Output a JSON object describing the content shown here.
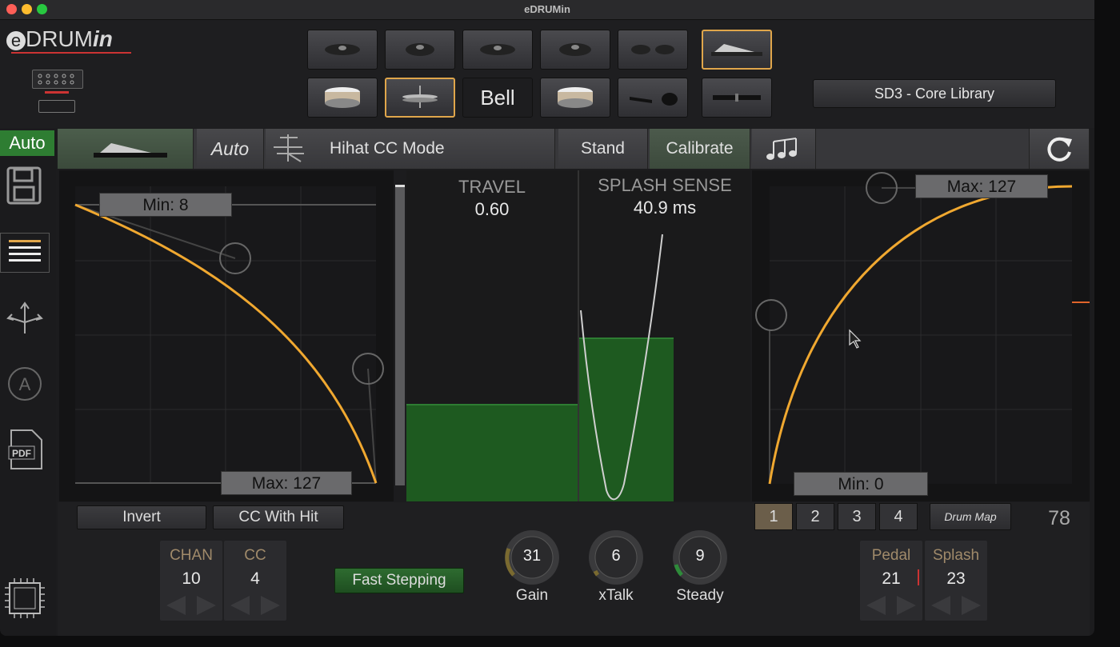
{
  "window": {
    "title": "eDRUMin"
  },
  "logo": {
    "text_e": "e",
    "text_drum": "DRUM",
    "text_in": "in"
  },
  "pads": {
    "row2_bell_label": "Bell"
  },
  "kit": {
    "name": "SD3 - Core Library"
  },
  "sidebar": {
    "auto_label": "Auto"
  },
  "toolbar": {
    "auto_label": "Auto",
    "mode_label": "Hihat CC Mode",
    "stand_label": "Stand",
    "calibrate_label": "Calibrate"
  },
  "left_curve": {
    "min_label": "Min: 8",
    "max_label": "Max: 127"
  },
  "travel": {
    "title": "TRAVEL",
    "value": "0.60",
    "level": 0.29
  },
  "splash": {
    "title": "SPLASH SENSE",
    "value": "40.9 ms",
    "level": 0.49
  },
  "right_curve": {
    "max_label": "Max: 127",
    "min_label": "Min: 0"
  },
  "buttons": {
    "invert": "Invert",
    "cc_with_hit": "CC With Hit",
    "fast_stepping": "Fast Stepping",
    "drum_map": "Drum Map"
  },
  "chan": {
    "label": "CHAN",
    "value": "10"
  },
  "cc": {
    "label": "CC",
    "value": "4"
  },
  "knobs": [
    {
      "value": "31",
      "label": "Gain"
    },
    {
      "value": "6",
      "label": "xTalk"
    },
    {
      "value": "9",
      "label": "Steady"
    }
  ],
  "zones": [
    "1",
    "2",
    "3",
    "4"
  ],
  "readout": "78",
  "pedal": {
    "label": "Pedal",
    "value": "21"
  },
  "splash_note": {
    "label": "Splash",
    "value": "23"
  },
  "colors": {
    "accent": "#e0a64b",
    "curve": "#f0a830",
    "green": "#1f5a22",
    "auto_green": "#2e7d32"
  }
}
